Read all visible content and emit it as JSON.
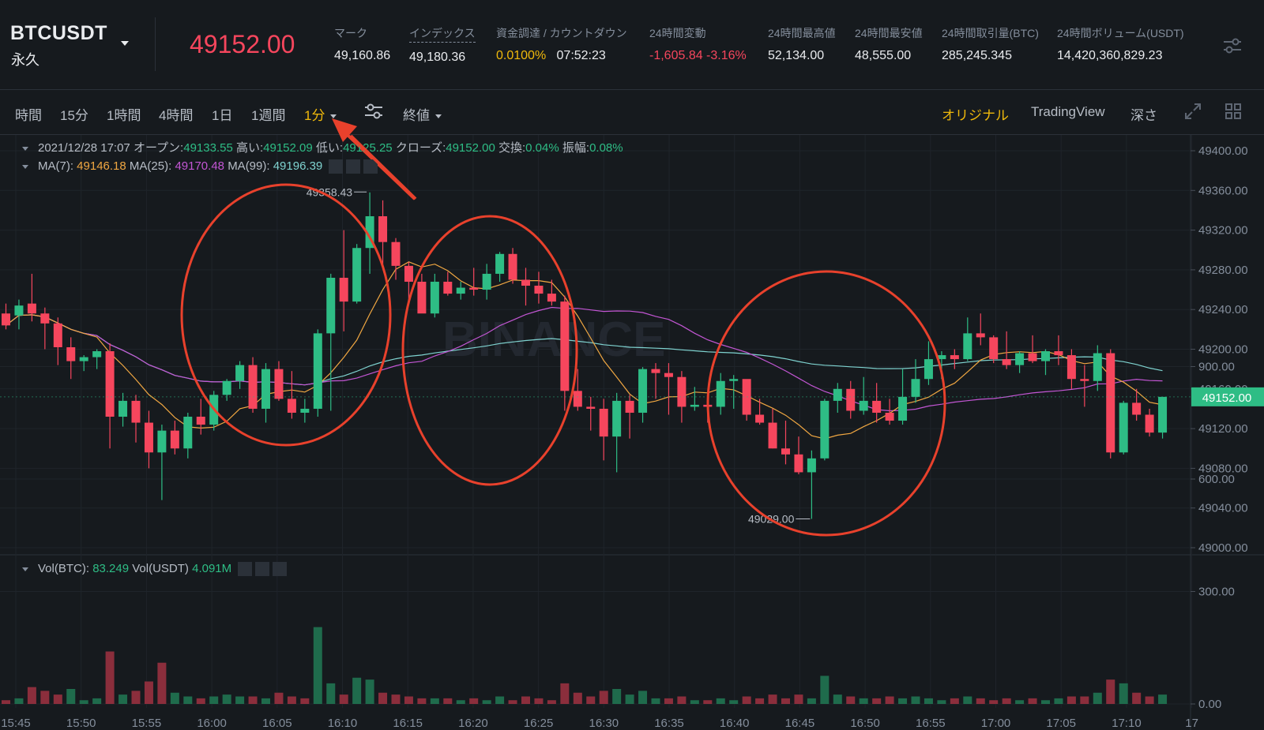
{
  "header": {
    "symbol": "BTCUSDT",
    "contract_type": "永久",
    "last_price": "49152.00",
    "stats": [
      {
        "label": "マーク",
        "value": "49,160.86"
      },
      {
        "label": "インデックス",
        "value": "49,180.36"
      },
      {
        "label": "資金調達 / カウントダウン",
        "value_a": "0.0100%",
        "value_b": "07:52:23"
      },
      {
        "label": "24時間変動",
        "value": "-1,605.84 -3.16%"
      },
      {
        "label": "24時間最高値",
        "value": "52,134.00"
      },
      {
        "label": "24時間最安値",
        "value": "48,555.00"
      },
      {
        "label": "24時間取引量(BTC)",
        "value": "285,245.345"
      },
      {
        "label": "24時間ボリューム(USDT)",
        "value": "14,420,360,829.23"
      }
    ]
  },
  "toolbar": {
    "intervals": [
      "時間",
      "15分",
      "1時間",
      "4時間",
      "1日",
      "1週間"
    ],
    "active_interval": "1分",
    "price_type": "終値",
    "views": [
      "オリジナル",
      "TradingView",
      "深さ"
    ]
  },
  "legend": {
    "ohlc": {
      "date": "2021/12/28 17:07",
      "open_label": "オープン:",
      "open": "49133.55",
      "high_label": "高い:",
      "high": "49152.09",
      "low_label": "低い:",
      "low": "49125.25",
      "close_label": "クローズ:",
      "close": "49152.00",
      "change_label": "交換:",
      "change": "0.04%",
      "amplitude_label": "振幅:",
      "amplitude": "0.08%"
    },
    "ma": [
      {
        "label": "MA(7):",
        "value": "49146.18"
      },
      {
        "label": "MA(25):",
        "value": "49170.48"
      },
      {
        "label": "MA(99):",
        "value": "49196.39"
      }
    ],
    "vol": {
      "btc_label": "Vol(BTC):",
      "btc": "83.249",
      "usdt_label": "Vol(USDT)",
      "usdt": "4.091M"
    }
  },
  "watermark": "BINANCE",
  "annotations": {
    "high_marker": "49358.43",
    "low_marker": "49029.00"
  },
  "colors": {
    "up": "#2ebd85",
    "down": "#f6465d",
    "accent": "#f0b90b",
    "circle": "#e8412c"
  },
  "chart_data": {
    "type": "candlestick",
    "price_axis": {
      "min": 49000,
      "max": 49400,
      "ticks": [
        "49400.00",
        "49360.00",
        "49320.00",
        "49280.00",
        "49240.00",
        "49200.00",
        "49160.00",
        "49120.00",
        "49080.00",
        "49040.00",
        "49000.00"
      ]
    },
    "current_price_label": "49152.00",
    "volume_axis": {
      "ticks": [
        "900.00",
        "600.00",
        "300.00",
        "0.00"
      ],
      "max": 1000
    },
    "time_ticks": [
      "15:45",
      "15:50",
      "15:55",
      "16:00",
      "16:05",
      "16:10",
      "16:15",
      "16:20",
      "16:25",
      "16:30",
      "16:35",
      "16:40",
      "16:45",
      "16:50",
      "16:55",
      "17:00",
      "17:05",
      "17:10",
      "17"
    ],
    "candles": [
      [
        49236,
        49246,
        49220,
        49224
      ],
      [
        49234,
        49250,
        49220,
        49244
      ],
      [
        49246,
        49276,
        49228,
        49236
      ],
      [
        49236,
        49242,
        49200,
        49226
      ],
      [
        49226,
        49232,
        49184,
        49202
      ],
      [
        49202,
        49212,
        49170,
        49188
      ],
      [
        49188,
        49194,
        49178,
        49192
      ],
      [
        49192,
        49200,
        49180,
        49198
      ],
      [
        49198,
        49206,
        49100,
        49132
      ],
      [
        49132,
        49156,
        49122,
        49148
      ],
      [
        49148,
        49154,
        49106,
        49126
      ],
      [
        49126,
        49138,
        49080,
        49096
      ],
      [
        49096,
        49124,
        49048,
        49118
      ],
      [
        49118,
        49128,
        49094,
        49100
      ],
      [
        49100,
        49136,
        49090,
        49132
      ],
      [
        49132,
        49150,
        49114,
        49124
      ],
      [
        49124,
        49158,
        49118,
        49154
      ],
      [
        49154,
        49170,
        49148,
        49168
      ],
      [
        49168,
        49188,
        49160,
        49184
      ],
      [
        49184,
        49192,
        49136,
        49140
      ],
      [
        49140,
        49186,
        49126,
        49180
      ],
      [
        49180,
        49188,
        49148,
        49150
      ],
      [
        49150,
        49178,
        49130,
        49136
      ],
      [
        49136,
        49150,
        49126,
        49140
      ],
      [
        49140,
        49220,
        49132,
        49216
      ],
      [
        49216,
        49276,
        49138,
        49272
      ],
      [
        49272,
        49320,
        49218,
        49248
      ],
      [
        49248,
        49306,
        49246,
        49302
      ],
      [
        49302,
        49358,
        49276,
        49334
      ],
      [
        49334,
        49350,
        49284,
        49308
      ],
      [
        49308,
        49312,
        49270,
        49284
      ],
      [
        49284,
        49288,
        49248,
        49268
      ],
      [
        49268,
        49276,
        49238,
        49236
      ],
      [
        49236,
        49276,
        49232,
        49268
      ],
      [
        49268,
        49278,
        49254,
        49256
      ],
      [
        49256,
        49268,
        49250,
        49262
      ],
      [
        49262,
        49282,
        49254,
        49260
      ],
      [
        49260,
        49286,
        49250,
        49276
      ],
      [
        49276,
        49298,
        49268,
        49296
      ],
      [
        49296,
        49302,
        49266,
        49270
      ],
      [
        49270,
        49282,
        49244,
        49264
      ],
      [
        49264,
        49278,
        49246,
        49256
      ],
      [
        49256,
        49270,
        49244,
        49248
      ],
      [
        49248,
        49254,
        49138,
        49158
      ],
      [
        49158,
        49180,
        49138,
        49142
      ],
      [
        49142,
        49152,
        49118,
        49140
      ],
      [
        49140,
        49150,
        49088,
        49112
      ],
      [
        49112,
        49156,
        49076,
        49148
      ],
      [
        49148,
        49154,
        49110,
        49136
      ],
      [
        49136,
        49182,
        49126,
        49180
      ],
      [
        49180,
        49186,
        49150,
        49176
      ],
      [
        49176,
        49186,
        49134,
        49172
      ],
      [
        49172,
        49178,
        49126,
        49142
      ],
      [
        49142,
        49162,
        49138,
        49144
      ],
      [
        49144,
        49152,
        49126,
        49142
      ],
      [
        49142,
        49176,
        49134,
        49168
      ],
      [
        49168,
        49174,
        49140,
        49170
      ],
      [
        49170,
        49168,
        49128,
        49134
      ],
      [
        49134,
        49150,
        49124,
        49126
      ],
      [
        49126,
        49140,
        49100,
        49100
      ],
      [
        49100,
        49128,
        49084,
        49094
      ],
      [
        49094,
        49112,
        49074,
        49076
      ],
      [
        49076,
        49098,
        49029,
        49090
      ],
      [
        49090,
        49150,
        49088,
        49148
      ],
      [
        49148,
        49166,
        49136,
        49160
      ],
      [
        49160,
        49168,
        49130,
        49138
      ],
      [
        49138,
        49172,
        49134,
        49148
      ],
      [
        49148,
        49166,
        49126,
        49136
      ],
      [
        49136,
        49150,
        49124,
        49128
      ],
      [
        49128,
        49180,
        49124,
        49152
      ],
      [
        49152,
        49190,
        49146,
        49170
      ],
      [
        49170,
        49208,
        49164,
        49190
      ],
      [
        49190,
        49198,
        49170,
        49194
      ],
      [
        49194,
        49200,
        49180,
        49190
      ],
      [
        49190,
        49232,
        49188,
        49216
      ],
      [
        49216,
        49236,
        49204,
        49212
      ],
      [
        49212,
        49214,
        49186,
        49190
      ],
      [
        49190,
        49218,
        49180,
        49184
      ],
      [
        49184,
        49198,
        49176,
        49196
      ],
      [
        49196,
        49214,
        49186,
        49188
      ],
      [
        49188,
        49200,
        49174,
        49198
      ],
      [
        49198,
        49214,
        49184,
        49194
      ],
      [
        49194,
        49200,
        49160,
        49170
      ],
      [
        49170,
        49184,
        49142,
        49168
      ],
      [
        49168,
        49204,
        49158,
        49196
      ],
      [
        49196,
        49200,
        49090,
        49096
      ],
      [
        49096,
        49148,
        49094,
        49146
      ],
      [
        49146,
        49160,
        49128,
        49134
      ],
      [
        49134,
        49140,
        49112,
        49116
      ],
      [
        49116,
        49152,
        49110,
        49152
      ]
    ],
    "volumes": [
      [
        10,
        "d"
      ],
      [
        15,
        "u"
      ],
      [
        45,
        "d"
      ],
      [
        35,
        "d"
      ],
      [
        25,
        "d"
      ],
      [
        40,
        "u"
      ],
      [
        10,
        "u"
      ],
      [
        15,
        "u"
      ],
      [
        140,
        "d"
      ],
      [
        25,
        "u"
      ],
      [
        35,
        "d"
      ],
      [
        60,
        "d"
      ],
      [
        110,
        "d"
      ],
      [
        30,
        "u"
      ],
      [
        20,
        "u"
      ],
      [
        15,
        "d"
      ],
      [
        20,
        "u"
      ],
      [
        25,
        "u"
      ],
      [
        20,
        "u"
      ],
      [
        20,
        "d"
      ],
      [
        15,
        "u"
      ],
      [
        30,
        "d"
      ],
      [
        20,
        "d"
      ],
      [
        15,
        "d"
      ],
      [
        205,
        "u"
      ],
      [
        55,
        "u"
      ],
      [
        25,
        "d"
      ],
      [
        70,
        "u"
      ],
      [
        65,
        "u"
      ],
      [
        30,
        "d"
      ],
      [
        25,
        "d"
      ],
      [
        20,
        "d"
      ],
      [
        15,
        "d"
      ],
      [
        15,
        "u"
      ],
      [
        15,
        "d"
      ],
      [
        10,
        "u"
      ],
      [
        15,
        "d"
      ],
      [
        10,
        "u"
      ],
      [
        20,
        "u"
      ],
      [
        10,
        "d"
      ],
      [
        20,
        "d"
      ],
      [
        15,
        "d"
      ],
      [
        10,
        "d"
      ],
      [
        55,
        "d"
      ],
      [
        30,
        "d"
      ],
      [
        20,
        "d"
      ],
      [
        35,
        "d"
      ],
      [
        40,
        "u"
      ],
      [
        25,
        "u"
      ],
      [
        35,
        "u"
      ],
      [
        15,
        "u"
      ],
      [
        15,
        "d"
      ],
      [
        20,
        "d"
      ],
      [
        10,
        "u"
      ],
      [
        10,
        "d"
      ],
      [
        15,
        "u"
      ],
      [
        10,
        "u"
      ],
      [
        20,
        "d"
      ],
      [
        15,
        "d"
      ],
      [
        25,
        "d"
      ],
      [
        15,
        "d"
      ],
      [
        25,
        "d"
      ],
      [
        15,
        "u"
      ],
      [
        75,
        "u"
      ],
      [
        25,
        "u"
      ],
      [
        20,
        "d"
      ],
      [
        15,
        "u"
      ],
      [
        15,
        "d"
      ],
      [
        20,
        "d"
      ],
      [
        15,
        "u"
      ],
      [
        20,
        "u"
      ],
      [
        15,
        "u"
      ],
      [
        10,
        "u"
      ],
      [
        15,
        "d"
      ],
      [
        20,
        "u"
      ],
      [
        15,
        "d"
      ],
      [
        10,
        "d"
      ],
      [
        15,
        "d"
      ],
      [
        10,
        "u"
      ],
      [
        15,
        "d"
      ],
      [
        10,
        "u"
      ],
      [
        15,
        "u"
      ],
      [
        20,
        "d"
      ],
      [
        20,
        "d"
      ],
      [
        30,
        "u"
      ],
      [
        65,
        "d"
      ],
      [
        55,
        "u"
      ],
      [
        30,
        "d"
      ],
      [
        20,
        "d"
      ],
      [
        25,
        "u"
      ]
    ]
  }
}
